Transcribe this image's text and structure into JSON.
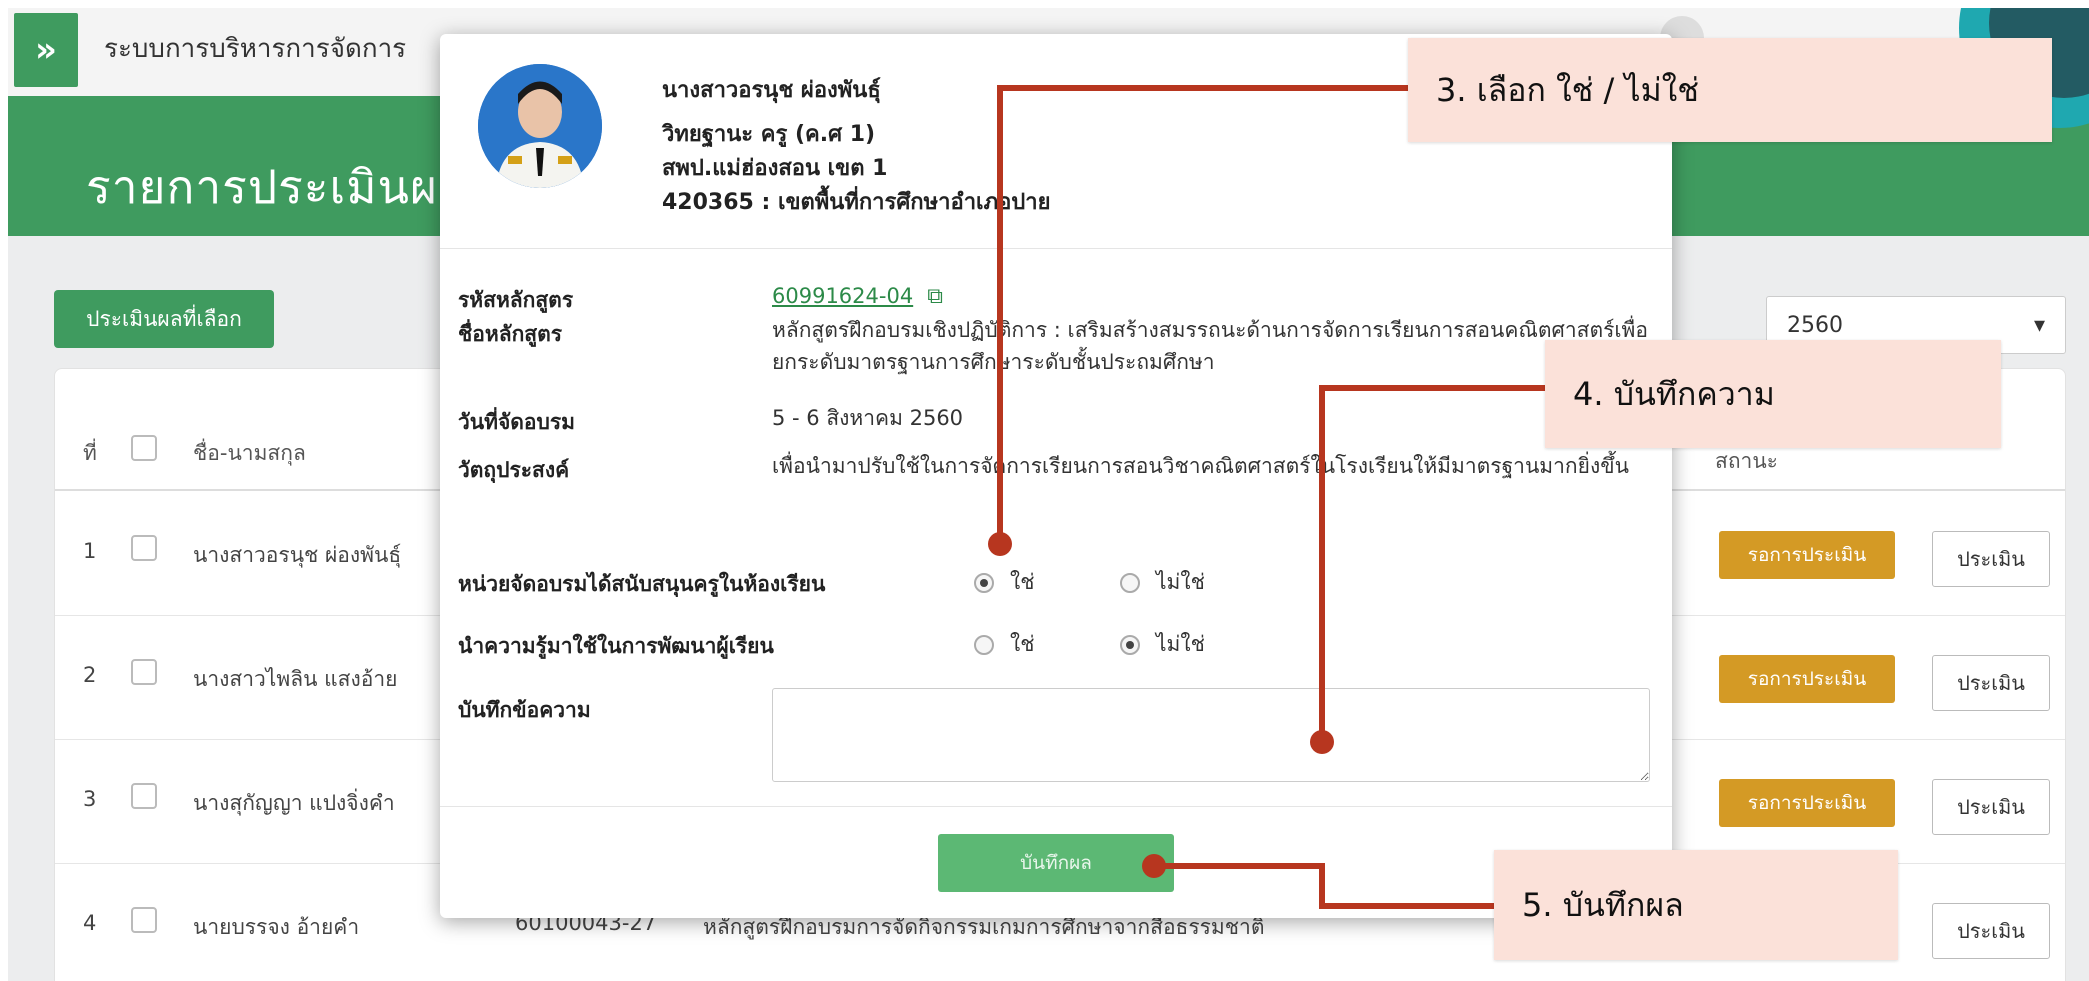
{
  "nav": {
    "toggle_glyph": "»",
    "title": "ระบบการบริหารการจัดการ"
  },
  "header": {
    "title": "รายการประเมินผล"
  },
  "toolbar": {
    "evaluate_selected_label": "ประเมินผลที่เลือก",
    "year_value": "2560",
    "year_arrow": "▾"
  },
  "list": {
    "headers": {
      "no": "ที่",
      "name": "ชื่อ-นามสกุล",
      "status": "สถานะ"
    },
    "rows": [
      {
        "no": "1",
        "name": "นางสาวอรนุช ผ่องพันธุ์",
        "code": "",
        "course": "",
        "status": "รอการประเมิน",
        "action": "ประเมิน"
      },
      {
        "no": "2",
        "name": "นางสาวไพลิน แสงอ้าย",
        "code": "",
        "course": "",
        "status": "รอการประเมิน",
        "action": "ประเมิน"
      },
      {
        "no": "3",
        "name": "นางสุกัญญา แปงจิ่งคำ",
        "code": "",
        "course": "",
        "status": "รอการประเมิน",
        "action": "ประเมิน"
      },
      {
        "no": "4",
        "name": "นายบรรจง อ้ายคำ",
        "code": "60100043-27",
        "course": "หลักสูตรฝึกอบรมการจัดกิจกรรมเกมการศึกษาจากสื่อธรรมชาติ",
        "status": "",
        "action": "ประเมิน"
      }
    ]
  },
  "modal": {
    "profile": {
      "name": "นางสาวอรนุช ผ่องพันธุ์",
      "rank": "วิทยฐานะ ครู (ค.ศ 1)",
      "office": "สพป.แม่ฮ่องสอน เขต 1",
      "school": "420365 : เขตพื้นที่การศึกษาอำเภอปาย"
    },
    "course": {
      "code_label": "รหัสหลักสูตร",
      "code_value": "60991624-04",
      "name_label": "ชื่อหลักสูตร",
      "name_value": "หลักสูตรฝึกอบรมเชิงปฏิบัติการ : เสริมสร้างสมรรถนะด้านการจัดการเรียนการสอนคณิตศาสตร์เพื่อยกระดับมาตรฐานการศึกษาระดับชั้นประถมศึกษา",
      "date_label": "วันที่จัดอบรม",
      "date_value": "5 - 6 สิงหาคม 2560",
      "objective_label": "วัตถุประสงค์",
      "objective_value": "เพื่อนำมาปรับใช้ในการจัดการเรียนการสอนวิชาคณิตศาสตร์ในโรงเรียนให้มีมาตรฐานมากยิ่งขึ้น"
    },
    "questions": [
      {
        "label": "หน่วยจัดอบรมได้สนับสนุนครูในห้องเรียน",
        "yes": "ใช่",
        "no": "ไม่ใช่",
        "selected": "yes"
      },
      {
        "label": "นำความรู้มาใช้ในการพัฒนาผู้เรียน",
        "yes": "ใช่",
        "no": "ไม่ใช่",
        "selected": "no"
      }
    ],
    "note_label": "บันทึกข้อความ",
    "note_value": "",
    "save_label": "บันทึกผล"
  },
  "callouts": {
    "c3": "3. เลือก  ใช่ / ไม่ใช่",
    "c4": "4. บันทึกความ",
    "c5": "5. บันทึกผล"
  },
  "colors": {
    "brand_green": "#3f9b5f",
    "status_orange": "#d49a25",
    "callout_bg": "#fbe1d9",
    "callout_line": "#b7361f"
  }
}
